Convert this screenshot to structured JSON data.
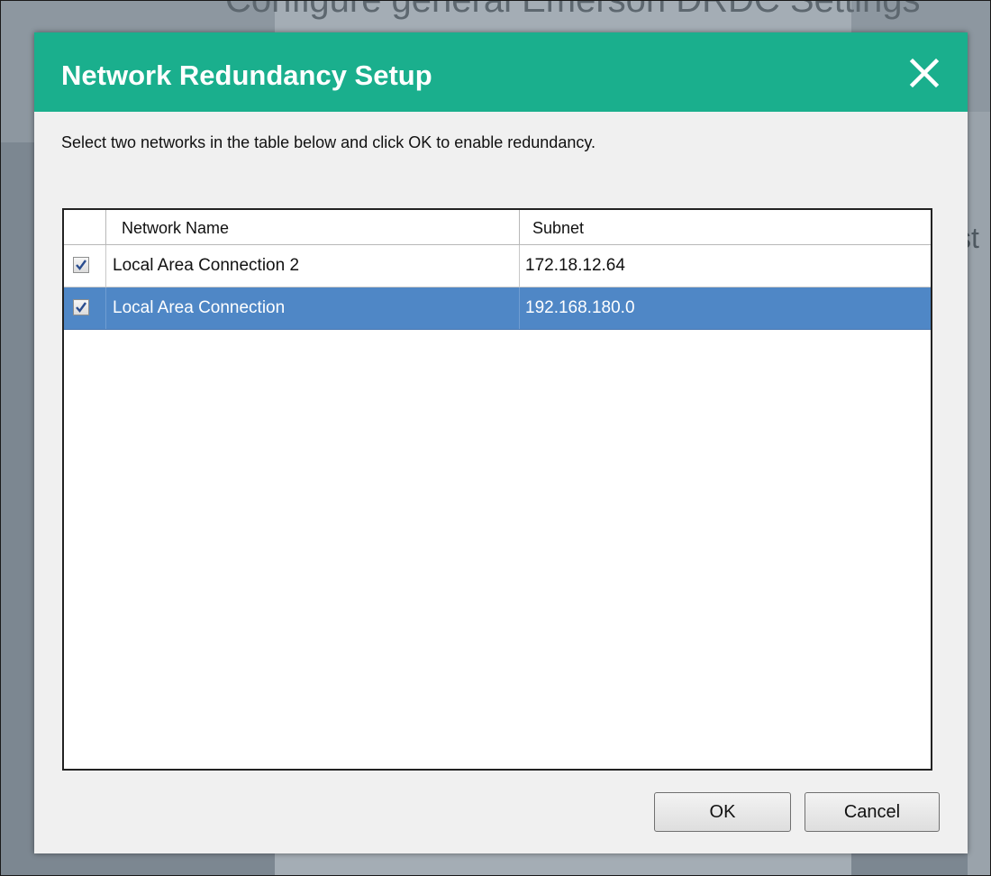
{
  "background": {
    "partial_text": "Configure general Emerson DRDC Settings",
    "partial_text_right": "st"
  },
  "dialog": {
    "title": "Network Redundancy Setup",
    "close_icon": "close-icon",
    "instructions": "Select two networks in the table below and click OK to enable redundancy.",
    "colors": {
      "title_bar": "#1aaf8d",
      "selected_row": "#4f87c6"
    }
  },
  "table": {
    "columns": [
      "Network Name",
      "Subnet"
    ],
    "rows": [
      {
        "checked": true,
        "network_name": "Local Area Connection 2",
        "subnet": "172.18.12.64",
        "selected": false
      },
      {
        "checked": true,
        "network_name": "Local Area Connection",
        "subnet": "192.168.180.0",
        "selected": true
      }
    ]
  },
  "buttons": {
    "ok": "OK",
    "cancel": "Cancel"
  }
}
